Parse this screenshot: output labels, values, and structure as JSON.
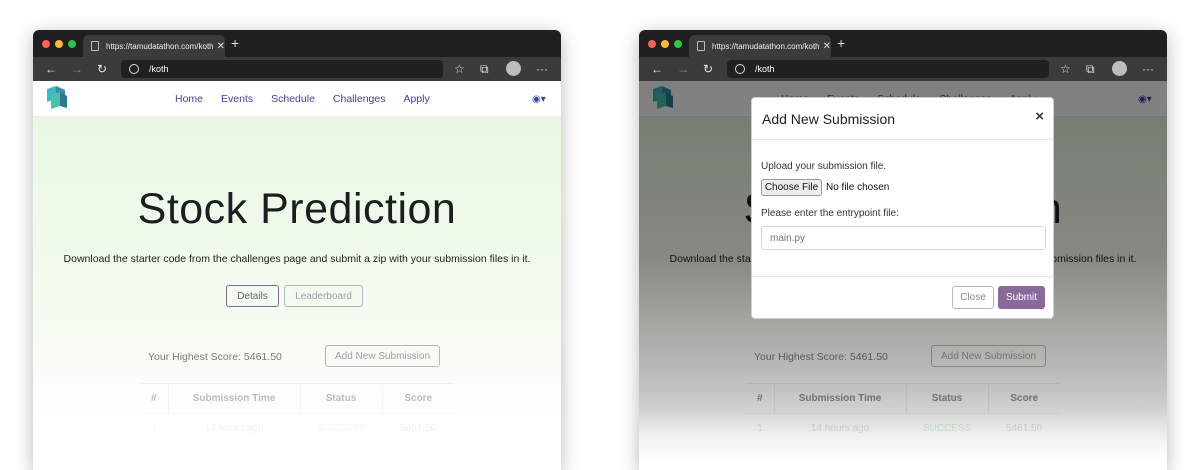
{
  "browser": {
    "tab_title": "https://tamudatathon.com/koth",
    "tab_close": "✕",
    "new_tab": "+",
    "url": "/koth",
    "icons": [
      "back-arrow-icon",
      "forward-arrow-icon",
      "reload-icon",
      "globe-icon",
      "favorites-icon",
      "collections-icon",
      "profile-icon",
      "more-icon"
    ],
    "more": "···"
  },
  "nav": {
    "links": [
      "Home",
      "Events",
      "Schedule",
      "Challenges",
      "Apply"
    ],
    "user_icon": "◉▾"
  },
  "page": {
    "title": "Stock Prediction",
    "description": "Download the starter code from the challenges page and submit a zip with your submission files in it.",
    "details_label": "Details",
    "leaderboard_label": "Leaderboard",
    "highest_score": "Your Highest Score: 5461.50",
    "add_submission_label": "Add New Submission"
  },
  "table": {
    "headers": [
      "#",
      "Submission Time",
      "Status",
      "Score"
    ],
    "rows": [
      [
        "1",
        "14 hours ago",
        "SUCCESS",
        "5461.50"
      ]
    ]
  },
  "modal": {
    "title": "Add New Submission",
    "close_glyph": "×",
    "upload_label": "Upload your submission file.",
    "choose_file": "Choose File",
    "no_file": "No file chosen",
    "entry_label": "Please enter the entrypoint file:",
    "entry_placeholder": "main.py",
    "close_label": "Close",
    "submit_label": "Submit"
  },
  "colors": {
    "accent": "#3f3faa",
    "submit": "#8a6a9c",
    "success": "#28a745"
  }
}
